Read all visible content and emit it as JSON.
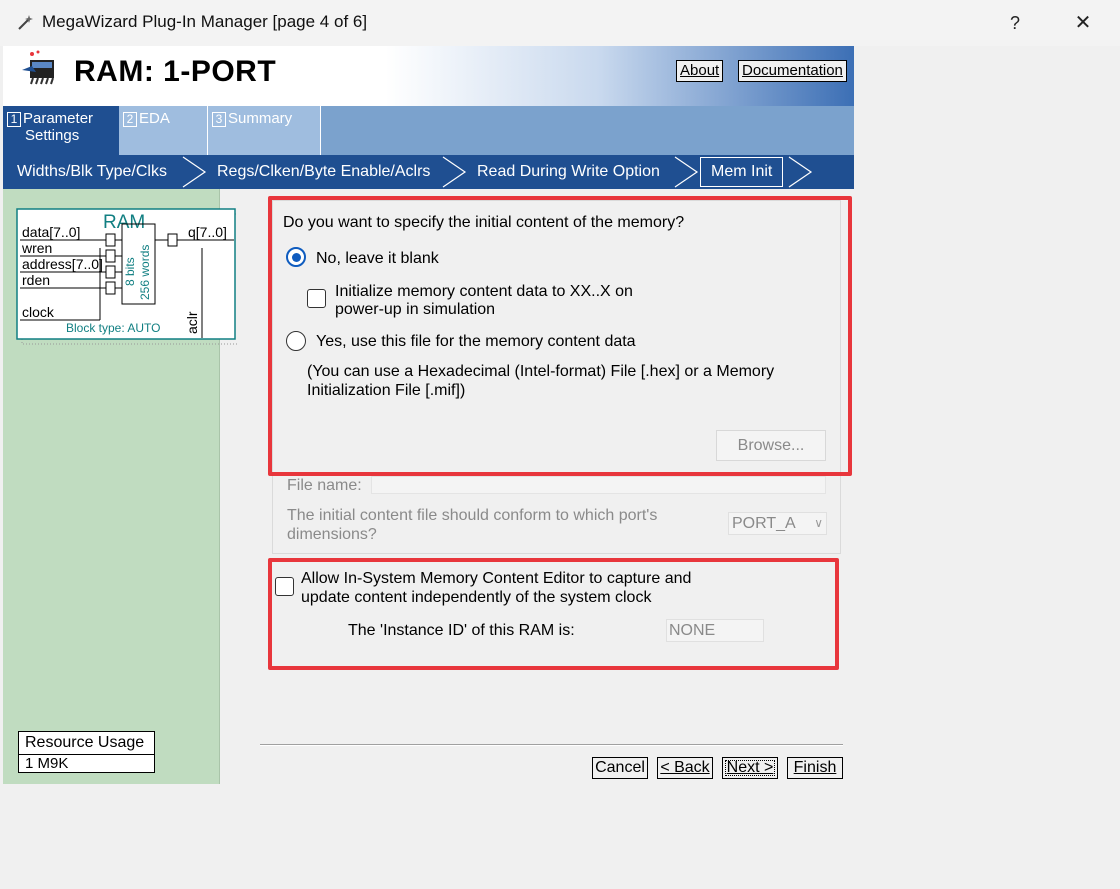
{
  "window": {
    "title": "MegaWizard Plug-In Manager [page 4 of 6]",
    "help_label": "?",
    "close_label": "✕"
  },
  "header": {
    "title": "RAM: 1-PORT",
    "about_label": "About",
    "documentation_label": "Documentation"
  },
  "tabs": [
    {
      "num": "1",
      "label_line1": "Parameter",
      "label_line2": "Settings"
    },
    {
      "num": "2",
      "label_line1": "EDA"
    },
    {
      "num": "3",
      "label_line1": "Summary"
    }
  ],
  "subtabs": [
    "Widths/Blk Type/Clks",
    "Regs/Clken/Byte Enable/Aclrs",
    "Read During Write Option",
    "Mem Init"
  ],
  "diagram": {
    "title": "RAM",
    "ports_in": [
      "data[7..0]",
      "wren",
      "address[7..0]",
      "rden",
      "clock"
    ],
    "port_out": "q[7..0]",
    "bits": "8 bits",
    "words": "256 words",
    "aclr": "aclr",
    "block_type": "Block type: AUTO"
  },
  "resource": {
    "title": "Resource Usage",
    "value": "1 M9K"
  },
  "init": {
    "question": "Do you want to specify the initial content of the memory?",
    "option_blank": "No, leave it blank",
    "init_check_line1": "Initialize memory content data to XX..X on",
    "init_check_line2": "power-up in simulation",
    "option_file": "Yes, use this file for the memory content data",
    "hint_line1": "(You can use a Hexadecimal (Intel-format) File [.hex] or a Memory",
    "hint_line2": "Initialization File [.mif])",
    "browse_label": "Browse...",
    "file_name_label": "File name:",
    "file_name_value": "",
    "port_question_line1": "The initial content file should conform to which port's",
    "port_question_line2": "dimensions?",
    "port_value": "PORT_A"
  },
  "insystem": {
    "label_line1": "Allow In-System Memory Content Editor to capture and",
    "label_line2": "update content independently of the system clock",
    "instance_label": "The 'Instance ID' of this RAM is:",
    "instance_value": "NONE"
  },
  "footer": {
    "cancel_label": "Cancel",
    "back_label": "< Back",
    "next_label": "Next >",
    "finish_label": "Finish"
  },
  "colors": {
    "accent_dark": "#1f4f91",
    "tab_bar": "#7ba2cd",
    "left_panel": "#c0dcc0",
    "highlight": "#e8363c",
    "diagram_teal": "#117f82"
  }
}
